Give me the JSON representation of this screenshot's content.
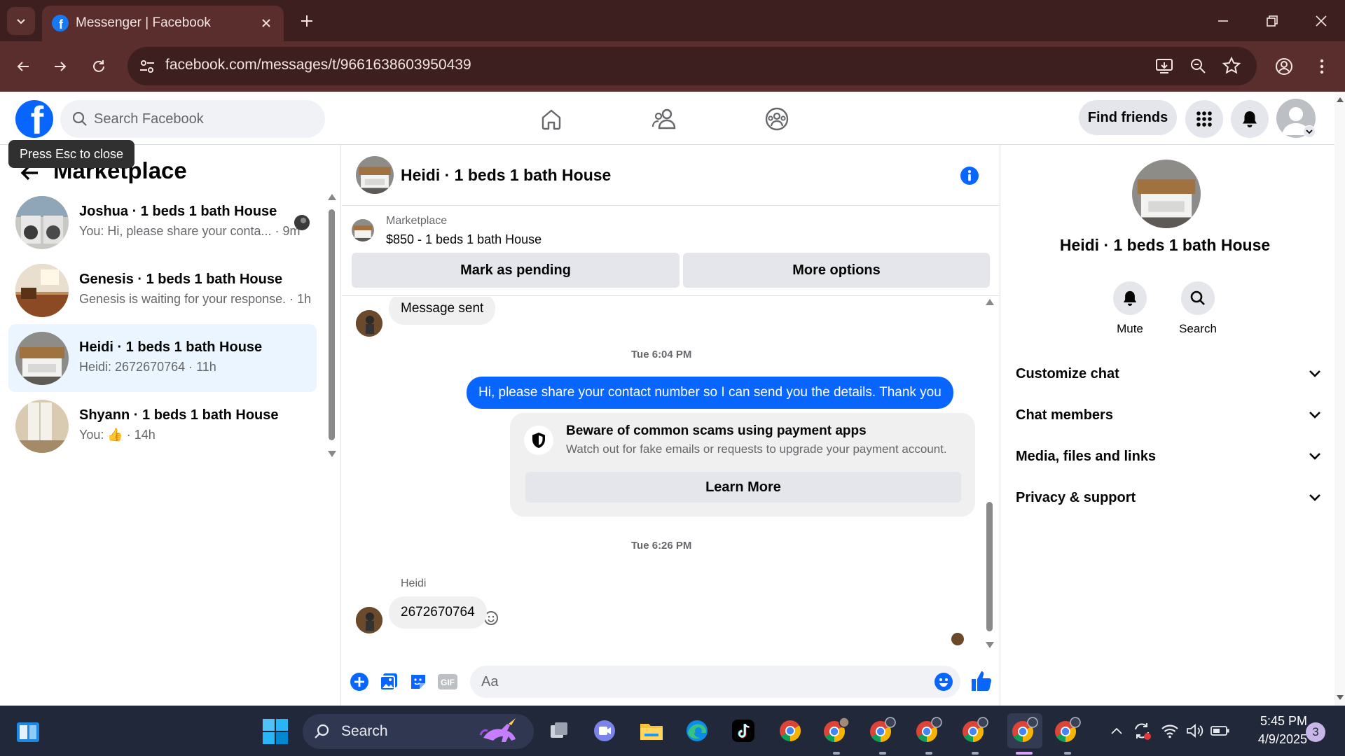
{
  "browser": {
    "tab_title": "Messenger | Facebook",
    "url": "facebook.com/messages/t/9661638603950439"
  },
  "fb_header": {
    "search_placeholder": "Search Facebook",
    "find_friends": "Find friends"
  },
  "left_panel": {
    "tooltip": "Press Esc to close",
    "title": "Marketplace",
    "chats": [
      {
        "name": "Joshua · 1 beds 1 bath House",
        "preview": "You: Hi, please share your conta... · 9m",
        "active": false
      },
      {
        "name": "Genesis · 1 beds 1 bath House",
        "preview": "Genesis is waiting for your response. · 1h",
        "active": false
      },
      {
        "name": "Heidi · 1 beds 1 bath House",
        "preview": "Heidi: 2672670764 · 11h",
        "active": true
      },
      {
        "name": "Shyann · 1 beds 1 bath House",
        "preview": "You: 👍 · 14h",
        "active": false
      }
    ]
  },
  "conversation": {
    "title": "Heidi · 1 beds 1 bath House",
    "listing_label": "Marketplace",
    "listing_price": "$850 - 1 beds 1 bath House",
    "mark_pending": "Mark as pending",
    "more_options": "More options",
    "messages": {
      "first_bubble": "Message sent",
      "timestamp_1": "Tue 6:04 PM",
      "outgoing": "Hi, please share your contact number so I can send you the details. Thank you",
      "warning_title": "Beware of common scams using payment apps",
      "warning_body": "Watch out for fake emails or requests to upgrade your payment account.",
      "learn_more": "Learn More",
      "timestamp_2": "Tue 6:26 PM",
      "sender": "Heidi",
      "incoming": "2672670764"
    },
    "composer_placeholder": "Aa"
  },
  "right_panel": {
    "name": "Heidi · 1 beds 1 bath House",
    "mute": "Mute",
    "search": "Search",
    "sections": [
      "Customize chat",
      "Chat members",
      "Media, files and links",
      "Privacy & support"
    ]
  },
  "taskbar": {
    "search_label": "Search",
    "time": "5:45 PM",
    "date": "4/9/2025",
    "notifications": "3"
  },
  "colors": {
    "fb_blue": "#0866ff",
    "chrome_dark": "#3c1f1e",
    "chrome_toolbar": "#5a2e2c",
    "taskbar": "#20283a"
  }
}
